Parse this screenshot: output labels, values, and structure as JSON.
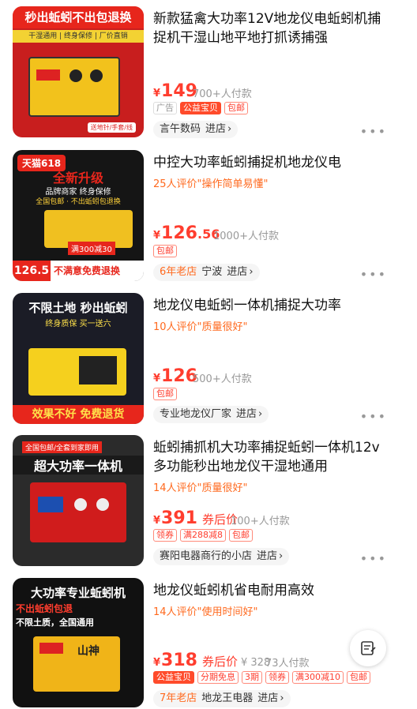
{
  "items": [
    {
      "title": "新款猛禽大功率12V地龙仪电蚯蚓机捕捉机干湿山地平地打抓诱捕强",
      "review": "",
      "yen": "¥",
      "price_int": "149",
      "price_dec": "",
      "sold": "700+人付款",
      "tags": [
        "广告",
        "公益宝贝",
        "包邮"
      ],
      "store_age": "",
      "store": "言午数码",
      "enter": "进店",
      "thumb_text": [
        "秒出蚯蚓不出包退换",
        "干湿通用 | 终身保修 | 厂价直销",
        "送地针/手套/线"
      ]
    },
    {
      "title": "中控大功率蚯蚓捕捉机地龙仪电",
      "review": "25人评价\"操作简单易懂\"",
      "yen": "¥",
      "price_int": "126",
      "price_dec": ".56",
      "sold": "1000+人付款",
      "tags": [
        "包邮"
      ],
      "store_age": "6年老店",
      "store": "宁波",
      "enter": "进店",
      "thumb_text": [
        "天猫618",
        "全新升级",
        "品牌商家 终身保修",
        "全国包邮 · 不出蚯蚓包退换",
        "满300减30",
        "126.5",
        "不满意免费退换"
      ]
    },
    {
      "title": "地龙仪电蚯蚓一体机捕捉大功率",
      "review": "10人评价\"质量很好\"",
      "yen": "¥",
      "price_int": "126",
      "price_dec": "",
      "sold": "500+人付款",
      "tags": [
        "包邮"
      ],
      "store_age": "",
      "store": "专业地龙仪厂家",
      "enter": "进店",
      "thumb_text": [
        "不限土地 秒出蚯蚓",
        "终身质保 买一送六",
        "效果不好 免费退货"
      ]
    },
    {
      "title": "蚯蚓捕抓机大功率捕捉蚯蚓一体机12v多功能秒出地龙仪干湿地通用",
      "review": "14人评价\"质量很好\"",
      "yen": "¥",
      "price_int": "391",
      "price_dec": "",
      "coupon_label": "券后价",
      "sold": "100+人付款",
      "tags": [
        "领券",
        "满288减8",
        "包邮"
      ],
      "store_age": "",
      "store": "赛阳电器商行的小店",
      "enter": "进店",
      "thumb_text": [
        "全国包邮/全套到家即用",
        "超大功率一体机"
      ]
    },
    {
      "title": "地龙仪蚯蚓机省电耐用高效",
      "review": "14人评价\"使用时间好\"",
      "yen": "¥",
      "price_int": "318",
      "price_dec": "",
      "coupon_label": "券后价",
      "orig": "¥ 328",
      "sold": "73人付款",
      "tags": [
        "公益宝贝",
        "分期免息",
        "3期",
        "领券",
        "满300减10",
        "包邮"
      ],
      "store_age": "7年老店",
      "store": "地龙王电器",
      "enter": "进店",
      "thumb_text": [
        "大功率专业蚯蚓机",
        "不出蚯蚓包退",
        "不限土质，全国通用",
        "山神"
      ]
    }
  ],
  "colors": {
    "price": "#ff3d2e",
    "review": "#ff6a1f",
    "tag_solid": "#ff4b2b"
  },
  "icons": {
    "more": "more-dots-icon",
    "fab": "notes-icon"
  }
}
